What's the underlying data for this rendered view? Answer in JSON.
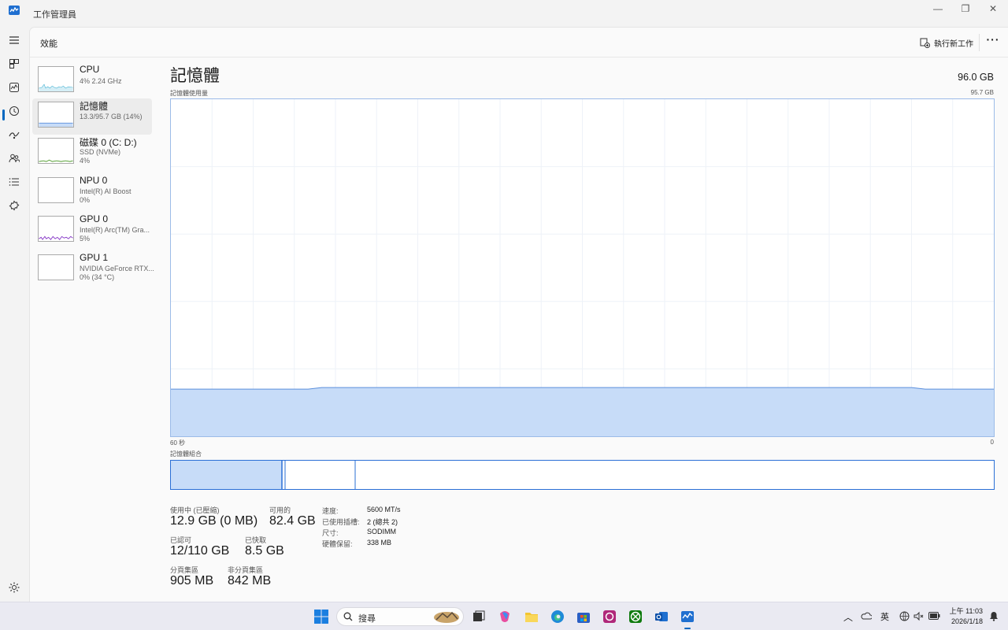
{
  "window": {
    "title": "工作管理員"
  },
  "header": {
    "title": "效能",
    "run_task_label": "執行新工作",
    "more_label": "···"
  },
  "nav": [
    "menu-icon",
    "processes-icon",
    "performance-icon",
    "app-history-icon",
    "startup-icon",
    "users-icon",
    "details-icon",
    "services-icon",
    "settings-icon"
  ],
  "perf_list": [
    {
      "name": "CPU",
      "sub1": "4%  2.24 GHz",
      "sub2": ""
    },
    {
      "name": "記憶體",
      "sub1": "13.3/95.7 GB (14%)",
      "sub2": ""
    },
    {
      "name": "磁碟 0 (C: D:)",
      "sub1": "SSD (NVMe)",
      "sub2": "4%"
    },
    {
      "name": "NPU 0",
      "sub1": "Intel(R) AI Boost",
      "sub2": "0%"
    },
    {
      "name": "GPU 0",
      "sub1": "Intel(R) Arc(TM) Gra...",
      "sub2": "5%"
    },
    {
      "name": "GPU 1",
      "sub1": "NVIDIA GeForce RTX...",
      "sub2": "0%  (34 °C)"
    }
  ],
  "detail": {
    "title": "記憶體",
    "total": "96.0 GB",
    "usage_label": "記憶體使用量",
    "graph_max": "95.7 GB",
    "time_left": "60 秒",
    "time_right": "0",
    "composition_label": "記憶體組合",
    "usage_fraction": 0.14
  },
  "stats": {
    "in_use_label": "使用中 (已壓縮)",
    "in_use_value": "12.9 GB (0 MB)",
    "available_label": "可用的",
    "available_value": "82.4 GB",
    "committed_label": "已認可",
    "committed_value": "12/110 GB",
    "cached_label": "已快取",
    "cached_value": "8.5 GB",
    "paged_label": "分頁集區",
    "paged_value": "905 MB",
    "nonpaged_label": "非分頁集區",
    "nonpaged_value": "842 MB"
  },
  "props": [
    {
      "label": "速度:",
      "value": "5600 MT/s"
    },
    {
      "label": "已使用插槽:",
      "value": "2 (總共 2)"
    },
    {
      "label": "尺寸:",
      "value": "SODIMM"
    },
    {
      "label": "硬體保留:",
      "value": "338 MB"
    }
  ],
  "taskbar": {
    "search_placeholder": "搜尋",
    "ime": "英",
    "time": "上午 11:03",
    "date": "2026/1/18"
  },
  "colors": {
    "accent": "#0067c0",
    "memory_fill": "#c7dcf8",
    "memory_line": "#5b8fdc"
  }
}
